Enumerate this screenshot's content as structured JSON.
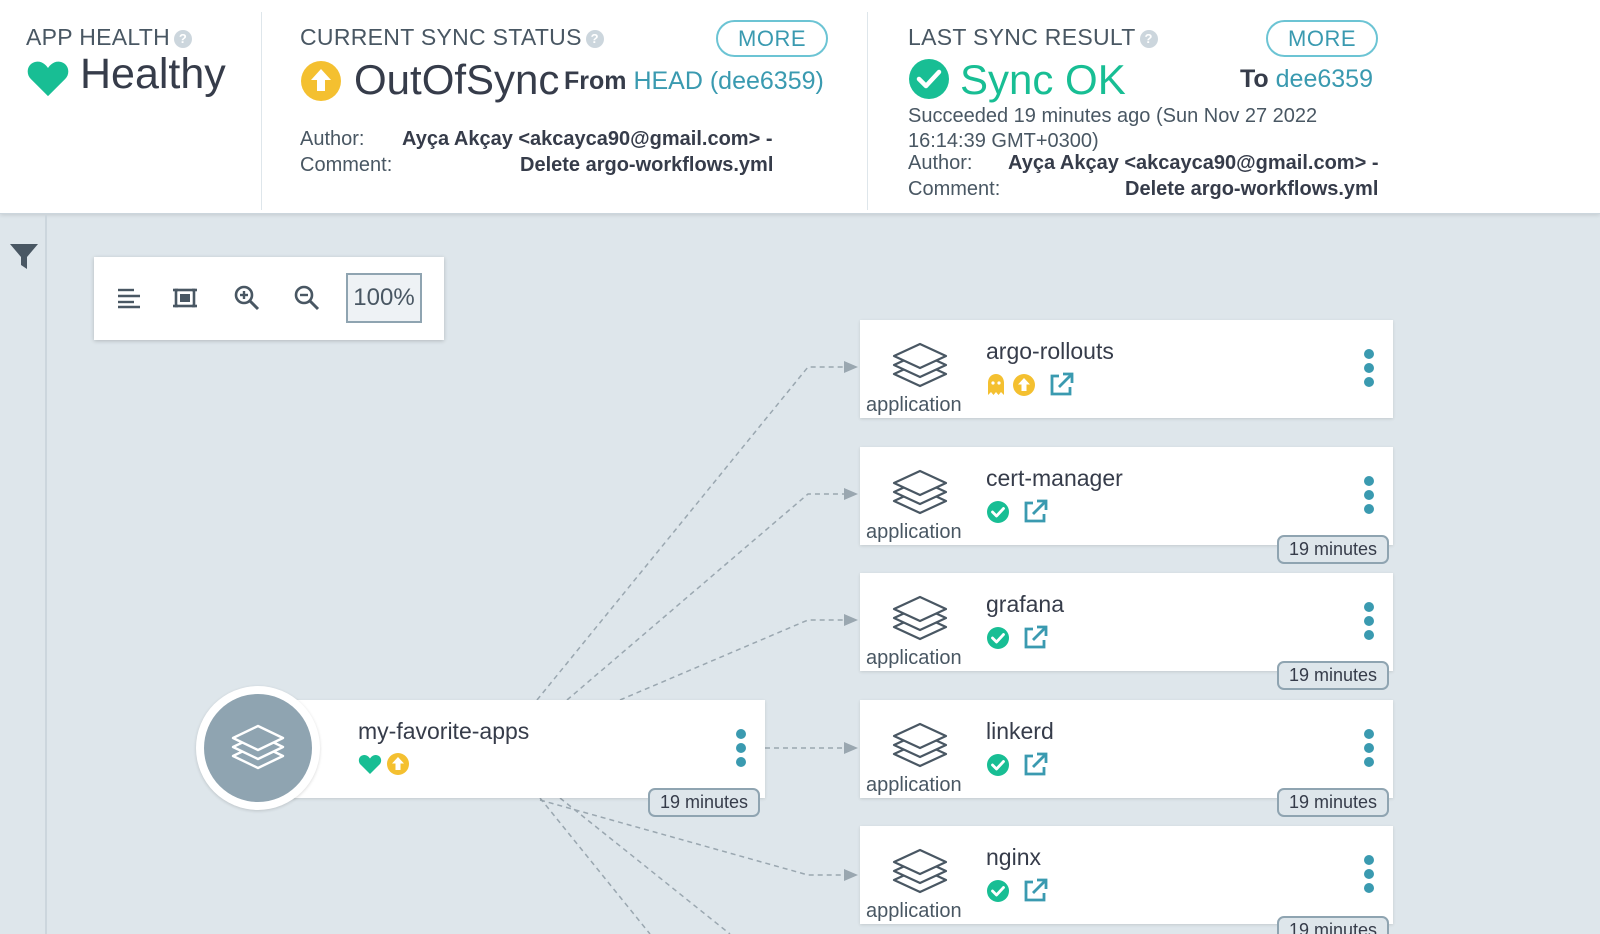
{
  "header": {
    "app_health": {
      "title": "APP HEALTH",
      "value": "Healthy",
      "color": "#18be94"
    },
    "current_sync": {
      "title": "CURRENT SYNC STATUS",
      "value": "OutOfSync",
      "from_label": "From",
      "revision": "HEAD (dee6359)",
      "more_label": "MORE",
      "author_label": "Author:",
      "author_value": "Ayça Akçay <akcayca90@gmail.com> -",
      "comment_label": "Comment:",
      "comment_value": "Delete argo-workflows.yml",
      "color": "#f4c030"
    },
    "last_sync": {
      "title": "LAST SYNC RESULT",
      "value": "Sync OK",
      "to_label": "To",
      "revision": "dee6359",
      "more_label": "MORE",
      "succeeded_line1": "Succeeded 19 minutes ago (Sun Nov 27 2022",
      "succeeded_line2": "16:14:39 GMT+0300)",
      "author_label": "Author:",
      "author_value": "Ayça Akçay <akcayca90@gmail.com> -",
      "comment_label": "Comment:",
      "comment_value": "Delete argo-workflows.yml",
      "color": "#18be94"
    }
  },
  "toolbar": {
    "zoom": "100%",
    "icons": [
      "list-view-icon",
      "fit-screen-icon",
      "zoom-in-icon",
      "zoom-out-icon"
    ]
  },
  "graph": {
    "root": {
      "name": "my-favorite-apps",
      "age": "19 minutes",
      "status": [
        "healthy",
        "out-of-sync"
      ]
    },
    "children": [
      {
        "name": "argo-rollouts",
        "kind": "application",
        "status": [
          "missing",
          "out-of-sync",
          "external-link"
        ],
        "age": ""
      },
      {
        "name": "cert-manager",
        "kind": "application",
        "status": [
          "synced",
          "external-link"
        ],
        "age": "19 minutes"
      },
      {
        "name": "grafana",
        "kind": "application",
        "status": [
          "synced",
          "external-link"
        ],
        "age": "19 minutes"
      },
      {
        "name": "linkerd",
        "kind": "application",
        "status": [
          "synced",
          "external-link"
        ],
        "age": "19 minutes"
      },
      {
        "name": "nginx",
        "kind": "application",
        "status": [
          "synced",
          "external-link"
        ],
        "age": "19 minutes"
      }
    ]
  },
  "colors": {
    "accent": "#3a9ab0",
    "healthy": "#18be94",
    "out_of_sync": "#f4c030",
    "neutral": "#8fa4b1"
  }
}
